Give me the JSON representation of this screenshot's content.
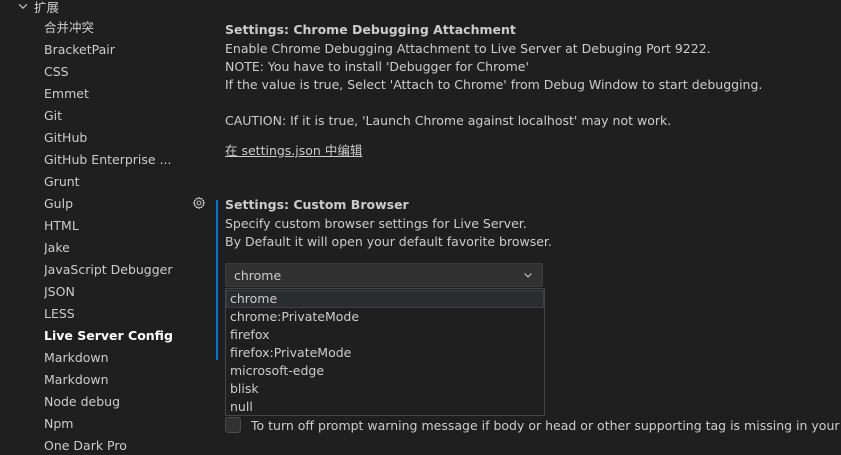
{
  "tree": {
    "header": "扩展",
    "items": [
      "合并冲突",
      "BracketPair",
      "CSS",
      "Emmet",
      "Git",
      "GitHub",
      "GitHub Enterprise ...",
      "Grunt",
      "Gulp",
      "HTML",
      "Jake",
      "JavaScript Debugger",
      "JSON",
      "LESS",
      "Live Server Config",
      "Markdown",
      "Markdown",
      "Node debug",
      "Npm",
      "One Dark Pro"
    ],
    "active_item": "Live Server Config"
  },
  "setting1": {
    "category": "Settings: ",
    "name": "Chrome Debugging Attachment",
    "desc1": "Enable Chrome Debugging Attachment to Live Server at Debuging Port 9222.",
    "desc2": "NOTE: You have to install 'Debugger for Chrome'",
    "desc3": "If the value is true, Select 'Attach to Chrome' from Debug Window to start debugging.",
    "desc4": "CAUTION: If it is true, 'Launch Chrome against localhost' may not work.",
    "edit_link": "在 settings.json 中编辑"
  },
  "setting2": {
    "category": "Settings: ",
    "name": "Custom Browser",
    "desc1": "Specify custom browser settings for Live Server.",
    "desc2": "By Default it will open your default favorite browser.",
    "selected": "chrome",
    "options": [
      "chrome",
      "chrome:PrivateMode",
      "firefox",
      "firefox:PrivateMode",
      "microsoft-edge",
      "blisk",
      "null"
    ]
  },
  "setting3": {
    "label": "To turn off prompt warning message if body or head or other supporting tag is missing in your HTML."
  },
  "colors": {
    "background": "#1f1f1f",
    "accent": "#0078d4",
    "text": "#cccccc"
  }
}
